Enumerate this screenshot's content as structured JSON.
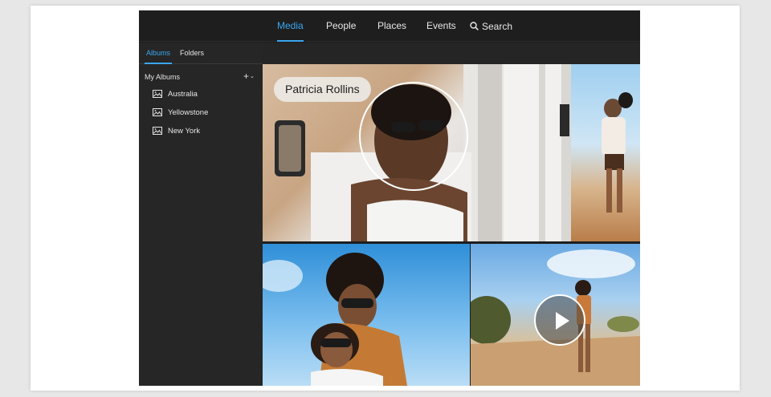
{
  "top_nav": {
    "tabs": [
      {
        "label": "Media",
        "active": true
      },
      {
        "label": "People",
        "active": false
      },
      {
        "label": "Places",
        "active": false
      },
      {
        "label": "Events",
        "active": false
      }
    ],
    "search_label": "Search",
    "search_icon": "search-icon"
  },
  "sidebar": {
    "tabs": [
      {
        "label": "Albums",
        "active": true
      },
      {
        "label": "Folders",
        "active": false
      }
    ],
    "section_title": "My Albums",
    "add_icon": "plus-icon",
    "albums": [
      {
        "label": "Australia",
        "icon": "image-icon"
      },
      {
        "label": "Yellowstone",
        "icon": "image-icon"
      },
      {
        "label": "New York",
        "icon": "image-icon"
      }
    ]
  },
  "grid": {
    "people_tag": "Patricia Rollins",
    "video_icon": "play-icon"
  },
  "colors": {
    "accent": "#3aa7f0",
    "app_bg": "#1e1e1e",
    "sidebar_bg": "#262626",
    "page_bg": "#e7e7e7"
  }
}
